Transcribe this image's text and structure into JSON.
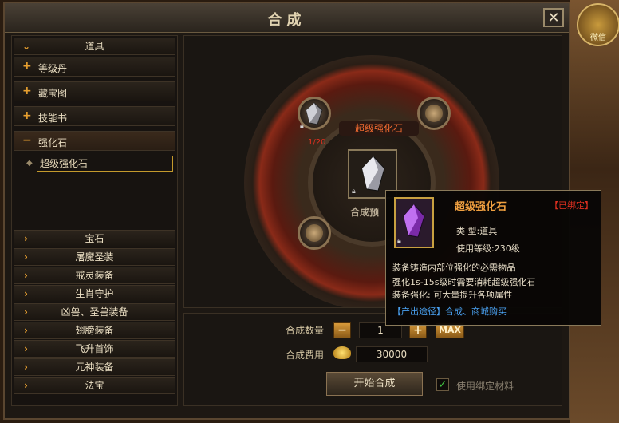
{
  "window": {
    "title": "合成",
    "close_label": "✕"
  },
  "side_badge": {
    "label": "微信"
  },
  "left_panel": {
    "header": "道具",
    "categories": [
      {
        "label": "等级丹"
      },
      {
        "label": "藏宝图"
      },
      {
        "label": "技能书"
      },
      {
        "label": "强化石"
      }
    ],
    "active_subitem": "超级强化石",
    "collapsed": [
      {
        "label": "宝石"
      },
      {
        "label": "屠魔圣装"
      },
      {
        "label": "戒灵装备"
      },
      {
        "label": "生肖守护"
      },
      {
        "label": "凶兽、圣兽装备"
      },
      {
        "label": "翅膀装备"
      },
      {
        "label": "飞升首饰"
      },
      {
        "label": "元神装备"
      },
      {
        "label": "法宝"
      }
    ]
  },
  "synth": {
    "target_label": "超级强化石",
    "material_ratio": "1/20",
    "center_text": "合成预"
  },
  "controls": {
    "qty_label": "合成数量",
    "qty_value": "1",
    "max_label": "MAX",
    "cost_label": "合成费用",
    "cost_value": "30000",
    "start_label": "开始合成",
    "use_bound_label": "使用绑定材料"
  },
  "tooltip": {
    "name": "超级强化石",
    "bound": "【已绑定】",
    "type": "类    型:道具",
    "level": "使用等级:230级",
    "desc1": "装备铸造内部位强化的必需物品",
    "desc2": "强化1s-15s级时需要消耗超级强化石",
    "desc3": "装备强化: 可大量提升各项属性",
    "source": "【产出途径】合成、商城购买"
  }
}
